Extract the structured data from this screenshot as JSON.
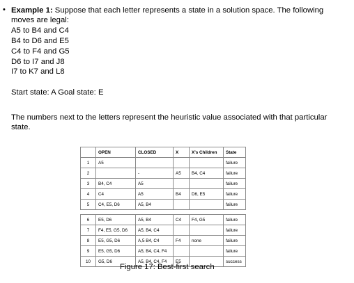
{
  "example": {
    "bullet": "•",
    "heading": "Example 1:",
    "intro_line1": "Suppose that each letter represents a state in a solution space.  The following",
    "intro_line2": "moves are legal:",
    "moves": [
      "A5 to B4 and C4",
      "B4 to D6 and E5",
      "C4 to F4 and G5",
      "D6 to I7 and J8",
      "I7 to K7 and L8"
    ],
    "start_goal": "Start state: A Goal state: E",
    "heuristic_line1": "The numbers next to the letters represent the heuristic value associated with that particular",
    "heuristic_line2": "state."
  },
  "table": {
    "headers": [
      "",
      "OPEN",
      "CLOSED",
      "X",
      "X's Children",
      "State"
    ],
    "rows": [
      [
        "1",
        "A5",
        "",
        "",
        "",
        "failure"
      ],
      [
        "2",
        "",
        "-",
        "A5",
        "B4, C4",
        "failure"
      ],
      [
        "3",
        "B4, C4",
        "A5",
        "",
        "",
        "failure"
      ],
      [
        "4",
        "C4",
        "A5",
        "B4",
        "D6, E5",
        "failure"
      ],
      [
        "5",
        "C4, E5, D6",
        "A5, B4",
        "",
        "",
        "failure"
      ],
      [
        "6",
        "E5, D6",
        "A5, B4",
        "C4",
        "F4, G5",
        "failure"
      ],
      [
        "7",
        "F4, E5, G5, D6",
        "A5, B4, C4",
        "",
        "",
        "failure"
      ],
      [
        "8",
        "E5, G5, D6",
        "A,5 B4, C4",
        "F4",
        "none",
        "failure"
      ],
      [
        "9",
        "E5,  G5, D6",
        "A5, B4, C4, F4",
        "",
        "",
        "failure"
      ],
      [
        "10",
        "G5, D6",
        "A5, B4, C4, F4",
        "E5",
        "",
        "success"
      ]
    ]
  },
  "caption": "Figure 17: Best-first search"
}
